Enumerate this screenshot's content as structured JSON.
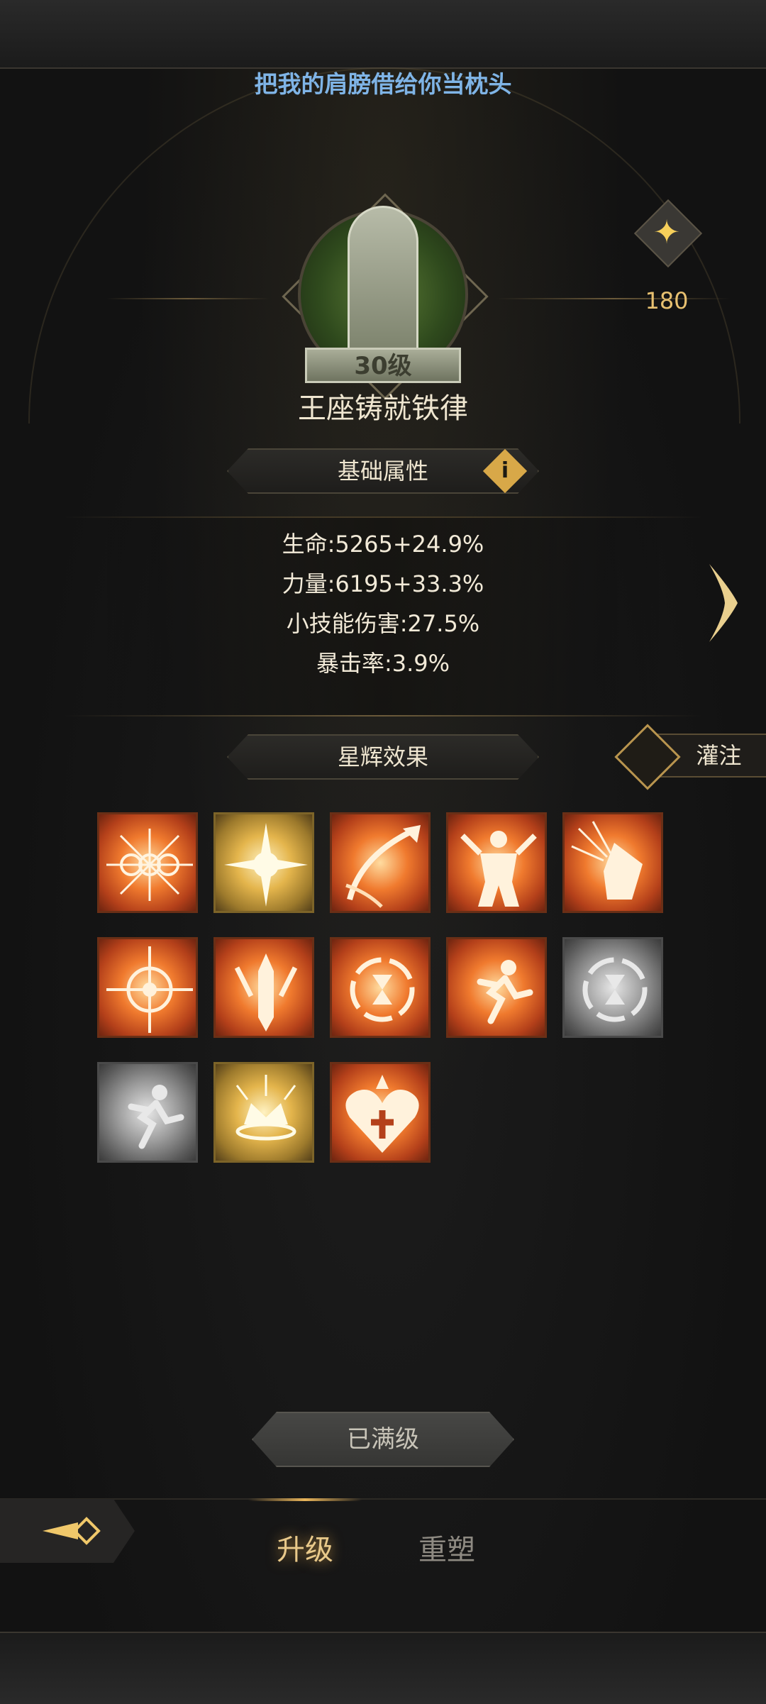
{
  "header": {
    "title": "把我的肩膀借给你当枕头"
  },
  "emblem": {
    "level": "30级",
    "name": "王座铸就铁律"
  },
  "points": {
    "icon": "sparkle-icon",
    "count": "180"
  },
  "attributes": {
    "section_label": "基础属性",
    "info_icon": "info-icon",
    "stats": [
      "生命:5265+24.9%",
      "力量:6195+33.3%",
      "小技能伤害:27.5%",
      "暴击率:3.9%"
    ]
  },
  "starlight": {
    "section_label": "星辉效果",
    "inject_label": "灌注",
    "icons": [
      {
        "name": "triple-burst-icon",
        "style": "orange"
      },
      {
        "name": "radiant-sun-icon",
        "style": "gold"
      },
      {
        "name": "sword-slash-icon",
        "style": "orange"
      },
      {
        "name": "power-figure-icon",
        "style": "orange"
      },
      {
        "name": "impact-strike-icon",
        "style": "orange"
      },
      {
        "name": "compass-burst-icon",
        "style": "orange"
      },
      {
        "name": "crowned-sword-icon",
        "style": "orange"
      },
      {
        "name": "hourglass-cycle-icon",
        "style": "orange"
      },
      {
        "name": "runner-burst-icon",
        "style": "orange"
      },
      {
        "name": "hourglass-cycle-icon",
        "style": "grey"
      },
      {
        "name": "runner-burst-icon",
        "style": "grey"
      },
      {
        "name": "radiant-crown-icon",
        "style": "gold"
      },
      {
        "name": "heart-cross-icon",
        "style": "orange"
      }
    ]
  },
  "actions": {
    "maxed_label": "已满级"
  },
  "bottom_tabs": {
    "upgrade": "升级",
    "reshape": "重塑"
  },
  "colors": {
    "title_blue": "#7fb4e6",
    "accent_gold": "#e9c98a",
    "points_gold": "#e7c070"
  }
}
